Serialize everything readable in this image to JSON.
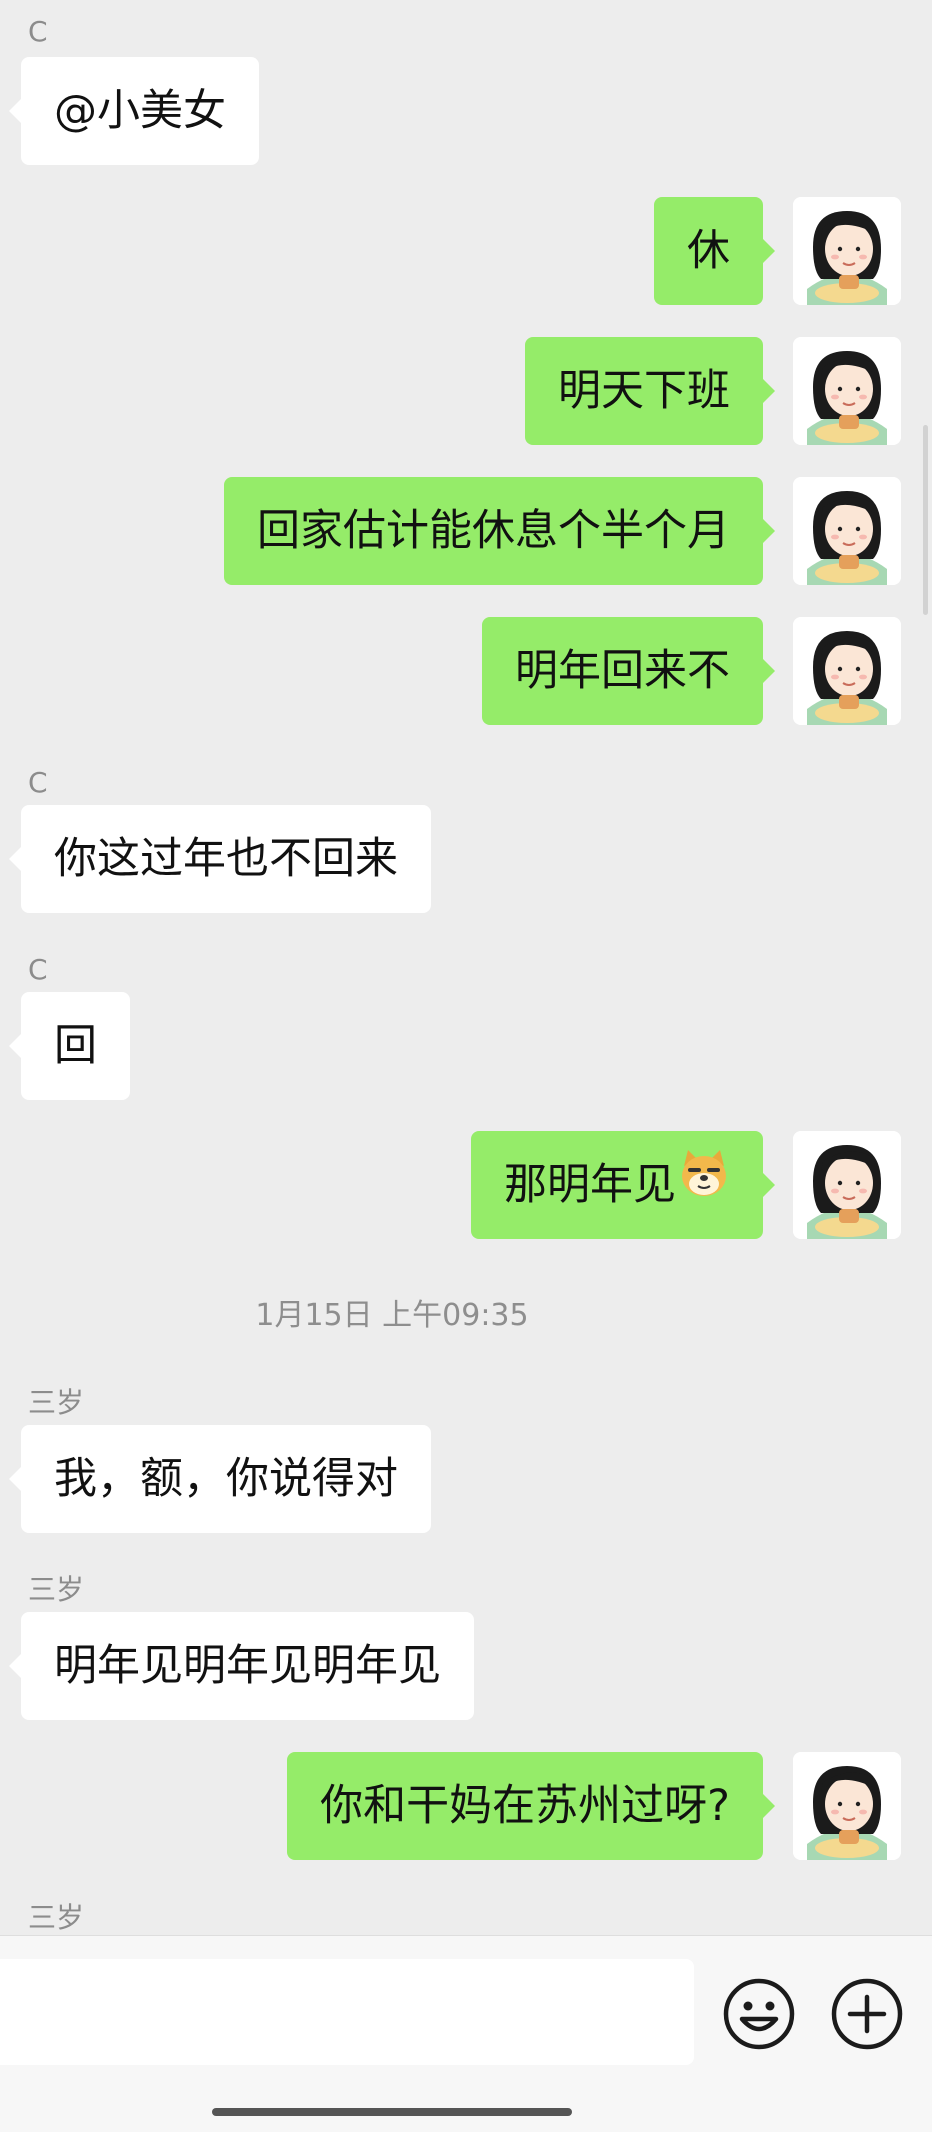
{
  "messages": [
    {
      "id": 1,
      "direction": "in",
      "sender": "C",
      "text": "@小美女"
    },
    {
      "id": 2,
      "direction": "out",
      "text": "休"
    },
    {
      "id": 3,
      "direction": "out",
      "text": "明天下班"
    },
    {
      "id": 4,
      "direction": "out",
      "text": "回家估计能休息个半个月"
    },
    {
      "id": 5,
      "direction": "out",
      "text": "明年回来不"
    },
    {
      "id": 6,
      "direction": "in",
      "sender": "C",
      "text": "你这过年也不回来"
    },
    {
      "id": 7,
      "direction": "in",
      "sender": "C",
      "text": "回"
    },
    {
      "id": 8,
      "direction": "out",
      "text": "那明年见",
      "emoji": "doge-emoji"
    },
    {
      "id": 9,
      "type": "timestamp",
      "text": "1月15日 上午09:35"
    },
    {
      "id": 10,
      "direction": "in",
      "sender": "三岁",
      "text": "我，额，你说得对"
    },
    {
      "id": 11,
      "direction": "in",
      "sender": "三岁",
      "text": "明年见明年见明年见"
    },
    {
      "id": 12,
      "direction": "out",
      "text": "你和干妈在苏州过呀?"
    },
    {
      "id": 13,
      "direction": "in",
      "sender": "三岁",
      "text": ""
    }
  ],
  "input": {
    "value": "",
    "placeholder": ""
  },
  "icons": {
    "emoji_button": "smiley-face-icon",
    "more_button": "plus-circle-icon"
  },
  "colors": {
    "background": "#ededed",
    "outgoing_bubble": "#95ec69",
    "incoming_bubble": "#ffffff",
    "sender_name": "#8c8c8c",
    "timestamp": "#8e8e8e"
  }
}
